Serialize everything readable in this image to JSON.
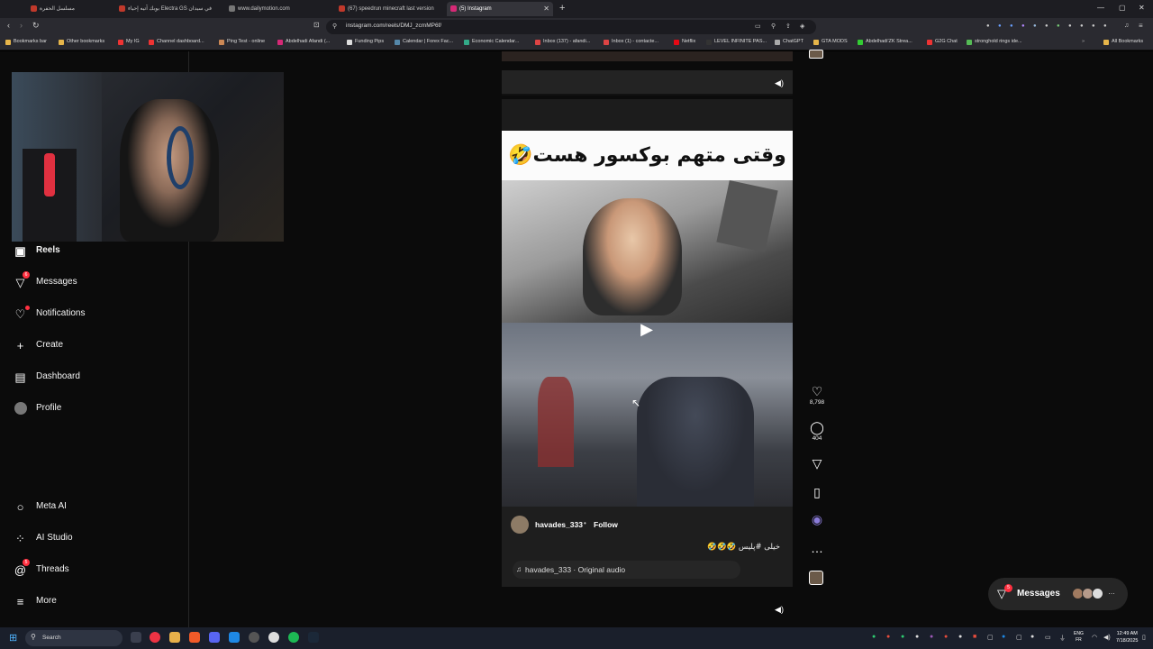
{
  "browser": {
    "tabs": [
      {
        "title": "مسلسل الحفرة",
        "color": "#c0392b"
      },
      {
        "title": "بوبك آتيه إحياء Electra GS في سيدان",
        "color": "#c0392b"
      },
      {
        "title": "www.dailymotion.com",
        "color": "#777"
      },
      {
        "title": "(67) speedrun minecraft last version",
        "color": "#c0392b"
      },
      {
        "title": "(5) Instagram",
        "color": "#d62976"
      }
    ],
    "active_tab_index": 4,
    "url": "instagram.com/reels/DMJ_zcmMP6f/",
    "bookmarks": [
      "Bookmarks bar",
      "Other bookmarks",
      "My IG",
      "Channel dashboard...",
      "Ping Test - online",
      "Abdelhadi Afandi (...",
      "Funding Pips",
      "Calendar | Forex Fac...",
      "Economic Calendar...",
      "Inbox (137) - afandi...",
      "Inbox (1) - contacte...",
      "Netflix",
      "LEVEL INFINITE PAS...",
      "ChatGPT",
      "GTA MODS",
      "Abdelhadi'ZK Strea...",
      "G2G Chat",
      "stronghold rings ide...",
      "All Bookmarks"
    ]
  },
  "sidebar": {
    "items": [
      {
        "label": "Reels",
        "icon": "reels-icon",
        "badge": ""
      },
      {
        "label": "Messages",
        "icon": "messages-icon",
        "badge": "6"
      },
      {
        "label": "Notifications",
        "icon": "heart-icon",
        "badge": ""
      },
      {
        "label": "Create",
        "icon": "plus-icon",
        "badge": ""
      },
      {
        "label": "Dashboard",
        "icon": "dashboard-icon",
        "badge": ""
      },
      {
        "label": "Profile",
        "icon": "avatar-icon",
        "badge": ""
      }
    ],
    "bottom_items": [
      {
        "label": "Meta AI",
        "icon": "meta-ai-icon",
        "badge": ""
      },
      {
        "label": "AI Studio",
        "icon": "ai-studio-icon",
        "badge": ""
      },
      {
        "label": "Threads",
        "icon": "threads-icon",
        "badge": "5"
      },
      {
        "label": "More",
        "icon": "menu-icon",
        "badge": ""
      }
    ]
  },
  "reel": {
    "caption_overlay": "وقتی متهم بوکسور هست🤣",
    "username": "havades_333",
    "separator": "•",
    "follow_label": "Follow",
    "description": "خیلی #پلیس 🤣🤣🤣",
    "audio": "havades_333 · Original audio",
    "likes": "8,798",
    "comments": "404"
  },
  "messages_pill": {
    "label": "Messages",
    "badge": "5"
  },
  "taskbar": {
    "search_placeholder": "Search",
    "lang_top": "ENG",
    "lang_bottom": "FR",
    "time": "12:49 AM",
    "date": "7/18/2025"
  },
  "colors": {
    "accent_red": "#ff3040",
    "page_bg": "#0b0b0b",
    "reel_panel": "#1e1e1e"
  }
}
